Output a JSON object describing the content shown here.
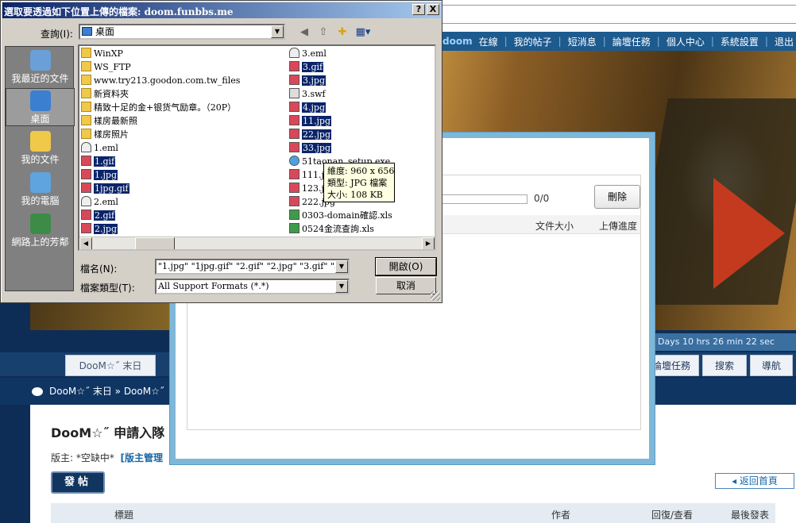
{
  "forum": {
    "nav": {
      "username": "doom",
      "items": [
        "在線",
        "我的帖子",
        "短消息",
        "論壇任務",
        "個人中心",
        "系統設置",
        "退出"
      ]
    },
    "countdown": "Days 10 hrs 26 min 22 sec",
    "home_tab": "DooM☆˝ 末日",
    "tabs": [
      "論壇任務",
      "搜索",
      "導航"
    ],
    "breadcrumb": "DooM☆˝ 末日 » DooM☆˝",
    "title": "DooM☆˝ 申請入隊",
    "moderator_prefix": "版主: *空缺中*",
    "moderator_link": "[版主管理",
    "post_button": "發帖",
    "back_home": "返回首頁",
    "table_headers": {
      "title": "標題",
      "author": "作者",
      "replies": "回復/查看",
      "last": "最後發表"
    }
  },
  "upload": {
    "progress_count": "0/0",
    "delete_button": "刪除",
    "col_size": "文件大小",
    "col_progress": "上傳進度"
  },
  "dialog": {
    "title": "選取要透過如下位置上傳的檔案: doom.funbbs.me",
    "help_btn": "?",
    "close_btn": "X",
    "lookin_label": "查詢(I):",
    "lookin_value": "桌面",
    "places": [
      {
        "label": "我最近的文件",
        "color": "#6a9fd8"
      },
      {
        "label": "桌面",
        "color": "#3b7fd1"
      },
      {
        "label": "我的文件",
        "color": "#f0c84a"
      },
      {
        "label": "我的電腦",
        "color": "#5fa4de"
      },
      {
        "label": "網路上的芳鄰",
        "color": "#3c8c48"
      }
    ],
    "files_col1": [
      {
        "name": "WinXP",
        "type": "folder",
        "sel": false
      },
      {
        "name": "WS_FTP",
        "type": "folder",
        "sel": false
      },
      {
        "name": "www.try213.goodon.com.tw_files",
        "type": "folder",
        "sel": false
      },
      {
        "name": "新資料夾",
        "type": "folder",
        "sel": false
      },
      {
        "name": "精致十足的金+银货气励章。（20P）",
        "type": "folder",
        "sel": false
      },
      {
        "name": "樣房最新照",
        "type": "folder",
        "sel": false
      },
      {
        "name": "樣房照片",
        "type": "folder",
        "sel": false
      },
      {
        "name": "1.eml",
        "type": "eml",
        "sel": false
      },
      {
        "name": "1.gif",
        "type": "img",
        "sel": true
      },
      {
        "name": "1.jpg",
        "type": "img",
        "sel": true
      },
      {
        "name": "1jpg.gif",
        "type": "img",
        "sel": true
      },
      {
        "name": "2.eml",
        "type": "eml",
        "sel": false
      },
      {
        "name": "2.gif",
        "type": "img",
        "sel": true
      },
      {
        "name": "2.jpg",
        "type": "img",
        "sel": true
      }
    ],
    "files_col2": [
      {
        "name": "3.eml",
        "type": "eml",
        "sel": false
      },
      {
        "name": "3.gif",
        "type": "img",
        "sel": true
      },
      {
        "name": "3.jpg",
        "type": "img",
        "sel": true
      },
      {
        "name": "3.swf",
        "type": "swf",
        "sel": false
      },
      {
        "name": "4.jpg",
        "type": "img",
        "sel": true
      },
      {
        "name": "11.jpg",
        "type": "img",
        "sel": true
      },
      {
        "name": "22.jpg",
        "type": "img",
        "sel": true
      },
      {
        "name": "33.jpg",
        "type": "img",
        "sel": true
      },
      {
        "name": "51taonan_setup.exe",
        "type": "exe",
        "sel": false
      },
      {
        "name": "111.jpg",
        "type": "img",
        "sel": false
      },
      {
        "name": "123.jpg",
        "type": "img",
        "sel": false
      },
      {
        "name": "222.jpg",
        "type": "img",
        "sel": false
      },
      {
        "name": "0303-domain確認.xls",
        "type": "xls",
        "sel": false
      },
      {
        "name": "0524金流查詢.xls",
        "type": "xls",
        "sel": false
      }
    ],
    "tooltip": [
      "維度: 960 x 656",
      "類型: JPG 檔案",
      "大小: 108 KB"
    ],
    "filename_label": "檔名(N):",
    "filename_value": "\"1.jpg\" \"1jpg.gif\" \"2.gif\" \"2.jpg\" \"3.gif\" \"3.jpg\"",
    "filetype_label": "檔案類型(T):",
    "filetype_value": "All Support Formats (*.*)",
    "open_button": "開啟(O)",
    "cancel_button": "取消"
  }
}
